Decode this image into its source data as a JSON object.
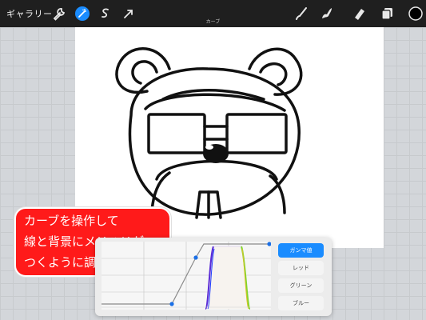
{
  "topbar": {
    "gallery_label": "ギャラリー",
    "left_tools": [
      "wrench-icon",
      "magic-wand-icon",
      "selection-icon",
      "transform-arrow-icon"
    ],
    "right_tools": [
      "brush-icon",
      "smudge-icon",
      "eraser-icon",
      "layers-icon",
      "color-swatch-icon"
    ],
    "active_tool": "magic-wand-icon",
    "accent_color": "#1a8cff",
    "current_color": "#000000"
  },
  "subtitle": "カーブ",
  "callout": {
    "lines": [
      "カーブを操作して",
      "線と背景にメリハリが",
      "つくように調整する"
    ],
    "color": "#ff1a1a"
  },
  "curves_panel": {
    "channels": [
      "ガンマ値",
      "レッド",
      "グリーン",
      "ブルー"
    ],
    "active_channel": "ガンマ値"
  }
}
